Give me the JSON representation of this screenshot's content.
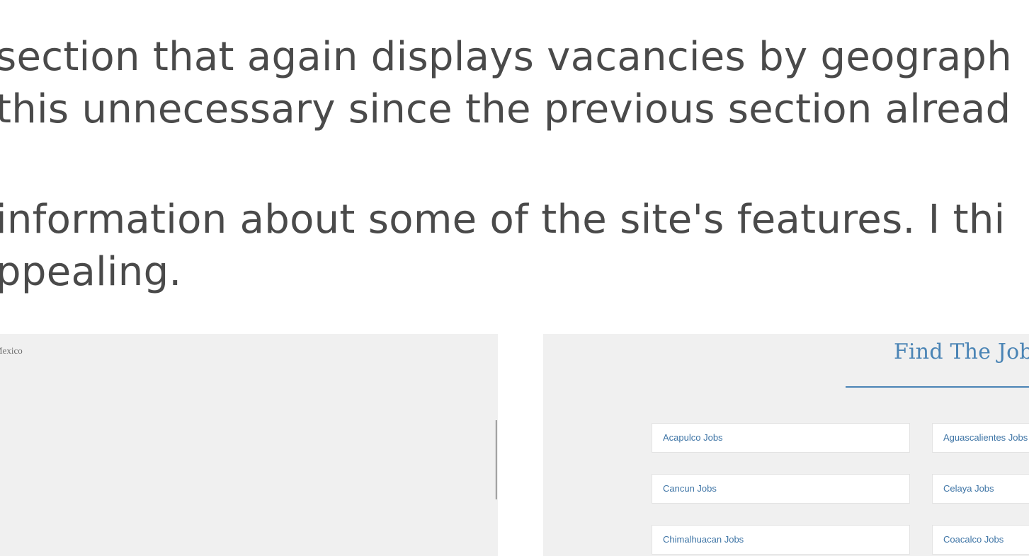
{
  "article": {
    "paragraph_1": {
      "line_1": "section that again displays vacancies by geograph",
      "line_2": "this unnecessary since the previous section alread"
    },
    "paragraph_2": {
      "line_1": "information about some of the site's features. I thi",
      "line_2": "ppealing."
    }
  },
  "left_screenshot": {
    "caption": "Mexico"
  },
  "right_screenshot": {
    "heading": "Find The Job",
    "jobs": [
      "Acapulco Jobs",
      "Aguascalientes Jobs",
      "Cancun Jobs",
      "Celaya Jobs",
      "Chimalhuacan Jobs",
      "Coacalco Jobs"
    ],
    "colors": {
      "accent": "#4a84b5",
      "link": "#3f75a6",
      "panel": "#f0f0f0"
    }
  }
}
